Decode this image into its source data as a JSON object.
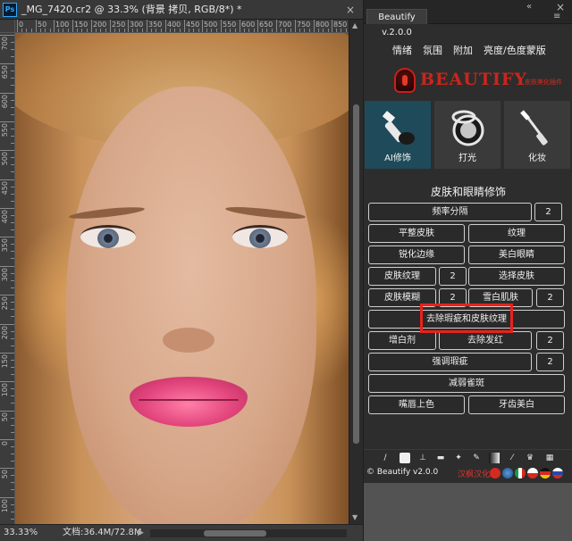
{
  "document": {
    "app_badge": "Ps",
    "title": "_MG_7420.cr2 @ 33.3% (背景 拷贝, RGB/8*) *",
    "close_glyph": "×",
    "zoom": "33.33%",
    "doc_size": "文档:36.4M/72.8M",
    "status_arrow": "▶",
    "ruler_top_labels": [
      "0",
      "50",
      "100",
      "150",
      "200",
      "250",
      "300",
      "350",
      "400",
      "450",
      "500",
      "550",
      "600",
      "650",
      "700",
      "750",
      "800",
      "850"
    ],
    "ruler_left_labels": [
      "700",
      "650",
      "600",
      "550",
      "500",
      "450",
      "400",
      "350",
      "300",
      "250",
      "200",
      "150",
      "100",
      "50",
      "0",
      "50",
      "100"
    ]
  },
  "panel": {
    "tab_label": "Beautify v.2.0.0",
    "minimize_glyph": "«",
    "close_glyph": "×",
    "menu_glyph": "≡",
    "menu": [
      "情绪",
      "氛围",
      "附加",
      "亮度/色度蒙版"
    ],
    "brand": {
      "name": "BEAUTIFY",
      "tagline": "皮肤美化插件"
    },
    "categories": [
      {
        "label": "AI修饰",
        "icon": "brush-icon",
        "active": true
      },
      {
        "label": "打光",
        "icon": "compact-mirror-icon",
        "active": false
      },
      {
        "label": "化妆",
        "icon": "mascara-icon",
        "active": false
      }
    ],
    "section_title": "皮肤和眼睛修饰",
    "buttons": {
      "freq_sep": "频率分隔",
      "freq_sep_n": "2",
      "smooth_skin": "平整皮肤",
      "texture": "纹理",
      "sharpen_edges": "锐化边缘",
      "whiten_eyes": "美白眼睛",
      "skin_texture": "皮肤纹理",
      "skin_texture_n": "2",
      "select_skin": "选择皮肤",
      "skin_blur": "皮肤模糊",
      "skin_blur_n": "2",
      "snow_skin": "雪白肌肤",
      "snow_skin_n": "2",
      "remove_blemish": "去除瑕疵和皮肤纹理",
      "whitener": "增白剂",
      "remove_redness": "去除发红",
      "remove_redness_n": "2",
      "emphasize_flaws": "强调瑕疵",
      "emphasize_flaws_n": "2",
      "reduce_freckles": "减弱雀斑",
      "lip_color": "嘴唇上色",
      "teeth_whiten": "牙齿美白"
    },
    "footer": {
      "copyright": "© Beautify v2.0.0",
      "edition": "汉枫汉化版"
    },
    "colors": {
      "accent_red": "#e8221c",
      "active_category": "#1e4a5a",
      "brand_red": "#c8261d"
    }
  }
}
